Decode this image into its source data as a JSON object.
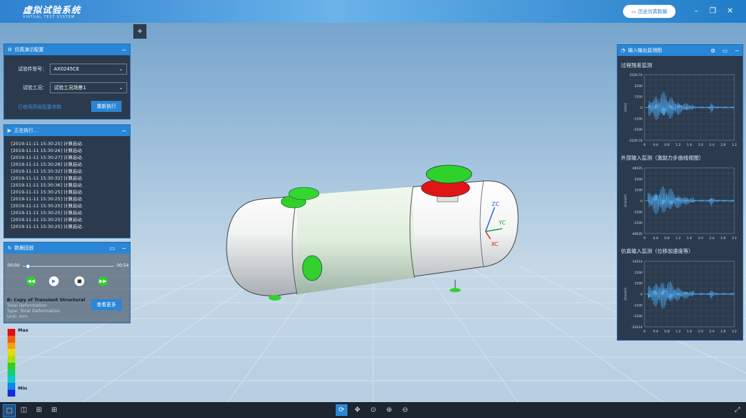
{
  "app": {
    "title": "虚拟试验系统",
    "subtitle": "VIRTUAL TEST SYSTEM",
    "history_button": "历史仿真数据"
  },
  "config_panel": {
    "title": "仿真演示配置",
    "model_label": "试验件型号：",
    "model_value": "AX0245CE",
    "condition_label": "试验工况：",
    "condition_value": "试验工况场景1",
    "advanced_link": "已使用高级配置参数",
    "rerun_button": "重新执行"
  },
  "log_panel": {
    "title": "正在执行...",
    "lines": [
      "[2019-11-11 15:30:25] 计算启动.",
      "[2019-11-11 15:30:26] 计算启动.",
      "[2019-11-11 15:30:27] 计算启动.",
      "[2019-11-11 15:30:28] 计算启动.",
      "[2019-11-11 15:30:32] 计算启动.",
      "[2019-11-11 15:30:32] 计算启动.",
      "[2019-11-11 15:30:36] 计算启动.",
      "[2019-11-11 15:30:25] 计算启动.",
      "[2019-11-11 15:30:25] 计算启动.",
      "[2019-11-11 15:30:25] 计算启动.",
      "[2019-11-11 15:30:25] 计算启动.",
      "[2019-11-11 15:30:25] 计算启动.",
      "[2019-11-11 15:30:25] 计算启动."
    ]
  },
  "playback_panel": {
    "title": "数据回放",
    "time_start": "00:00",
    "time_end": "00:54",
    "progress_fraction": 0.03,
    "more_button": "查看更多"
  },
  "overlay_text": {
    "line1": "B: Copy of Transient Structural",
    "line2": "Total Deformation",
    "line3": "Type: Total Deformation",
    "line4": "Unit: mm"
  },
  "legend": {
    "max_label": "Max",
    "min_label": "Min",
    "colors": [
      "#e01010",
      "#f06010",
      "#f5a010",
      "#e8d810",
      "#a8e010",
      "#30d020",
      "#10d080",
      "#10c8d0",
      "#1088e8",
      "#1030e0"
    ]
  },
  "model_axes": {
    "zc": "ZC",
    "yc": "YC",
    "xc": "XC"
  },
  "monitor_panel": {
    "title": "输入输出监测图",
    "charts": [
      {
        "title": "过程残差监测",
        "ylabel": "[mm]",
        "y_ticks": [
          "2229.74",
          "2100",
          "1100",
          "0",
          "-1100",
          "-2100",
          "-2229.74"
        ],
        "x_ticks": [
          "0",
          "0.4",
          "0.8",
          "1.2",
          "1.6",
          "2.0",
          "2.4",
          "2.8",
          "3.2"
        ]
      },
      {
        "title": "外部输入监测（激励力步曲线视图）",
        "ylabel": "[mm/s²]",
        "y_ticks": [
          "40035",
          "2100",
          "1100",
          "0",
          "-1100",
          "-2100",
          "-40035"
        ],
        "x_ticks": [
          "0",
          "0.4",
          "0.8",
          "1.2",
          "1.6",
          "2.0",
          "2.4",
          "2.8",
          "3.2"
        ]
      },
      {
        "title": "仿真输入监测（位移加速度等）",
        "ylabel": "[mm/s²]",
        "y_ticks": [
          "33214",
          "2100",
          "1100",
          "0",
          "-1100",
          "-2100",
          "-33214"
        ],
        "x_ticks": [
          "0",
          "0.4",
          "0.8",
          "1.2",
          "1.6",
          "2.0",
          "2.4",
          "2.8",
          "3.2"
        ]
      }
    ]
  },
  "colors": {
    "accent": "#2a86d6",
    "panel_bg": "#2b3a4d",
    "signal": "#4ea4e8"
  }
}
